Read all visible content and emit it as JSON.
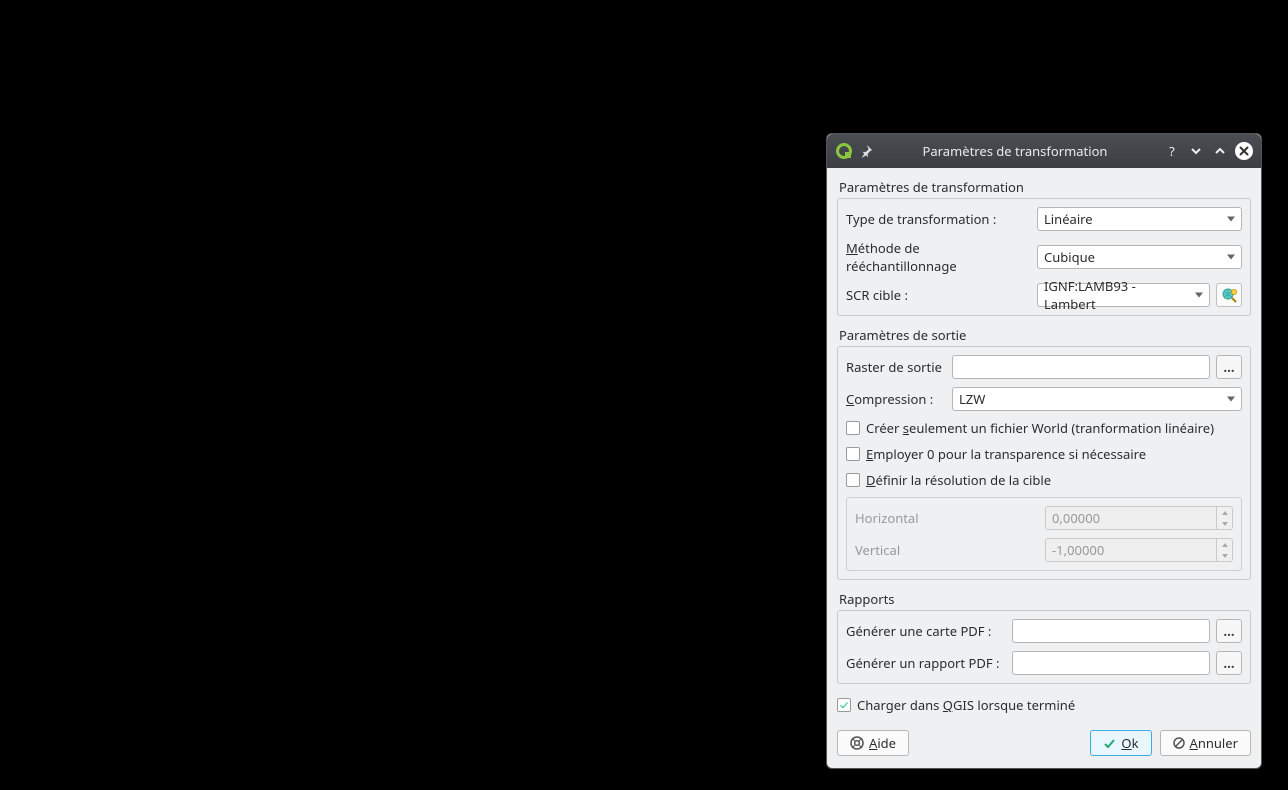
{
  "titlebar": {
    "title": "Paramètres de transformation"
  },
  "sections": {
    "transform": {
      "title": "Paramètres de transformation",
      "type_label_pre": "Type de transformation :",
      "type_value": "Linéaire",
      "method_label_pre": "M",
      "method_label_post": "éthode de rééchantillonnage",
      "method_value": "Cubique",
      "crs_label": "SCR cible :",
      "crs_value": "IGNF:LAMB93 - Lambert"
    },
    "output": {
      "title": "Paramètres de sortie",
      "raster_label": "Raster de sortie",
      "compression_label_pre": "C",
      "compression_label_post": "ompression :",
      "compression_value": "LZW",
      "cb_world_pre": "Créer ",
      "cb_world_u": "s",
      "cb_world_post": "eulement un fichier World (tranformation linéaire)",
      "cb_transparency_u": "E",
      "cb_transparency_post": "mployer 0 pour la transparence si nécessaire",
      "cb_resolution_u": "D",
      "cb_resolution_post": "éfinir la résolution de la cible",
      "res_h_label": "Horizontal",
      "res_h_value": "0,00000",
      "res_v_label": "Vertical",
      "res_v_value": "-1,00000"
    },
    "reports": {
      "title": "Rapports",
      "map_label": "Générer une carte PDF :",
      "report_label": "Générer un rapport PDF :"
    }
  },
  "load_checkbox_pre": "Charger dans ",
  "load_checkbox_u": "Q",
  "load_checkbox_post": "GIS lorsque terminé",
  "buttons": {
    "help_u": "A",
    "help_post": "ide",
    "ok_u": "O",
    "ok_post": "k",
    "cancel_u": "A",
    "cancel_post": "nnuler",
    "browse": "…"
  }
}
